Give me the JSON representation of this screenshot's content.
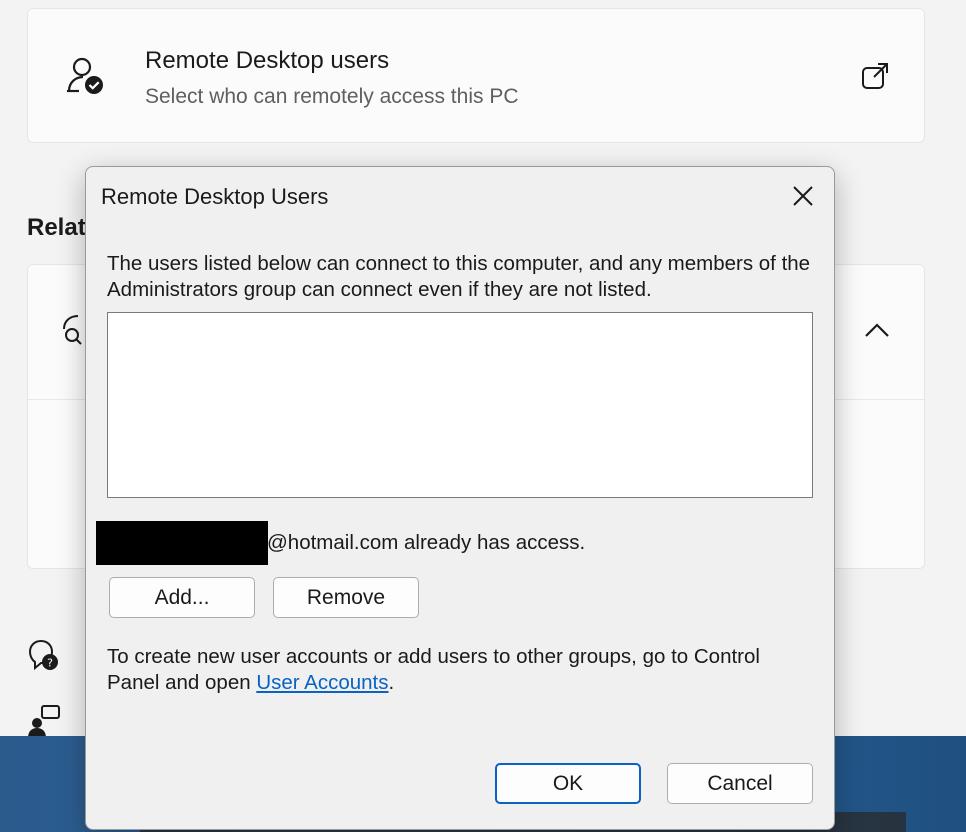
{
  "settings": {
    "rdp_card": {
      "title": "Remote Desktop users",
      "subtitle": "Select who can remotely access this PC",
      "icon": "users-check-icon",
      "action_icon": "open-external-icon"
    },
    "related_heading": "Relat",
    "related_card": {
      "icon": "search-network-icon",
      "chevron": "chevron-up-icon"
    },
    "side_icons": [
      "help-icon",
      "feedback-icon"
    ]
  },
  "dialog": {
    "title": "Remote Desktop Users",
    "close_icon": "close-icon",
    "description": "The users listed below can connect to this computer, and any members of the Administrators group can connect even if they are not listed.",
    "user_list": [],
    "access_text": "@hotmail.com already has access.",
    "add_label": "Add...",
    "remove_label": "Remove",
    "footer_text": "To create new user accounts or add users to other groups, go to Control Panel and open ",
    "footer_link": "User Accounts",
    "footer_end": ".",
    "ok_label": "OK",
    "cancel_label": "Cancel"
  },
  "colors": {
    "link": "#0a62c4",
    "dialog_bg": "#f0f0f0",
    "page_bg": "#f3f3f3"
  }
}
